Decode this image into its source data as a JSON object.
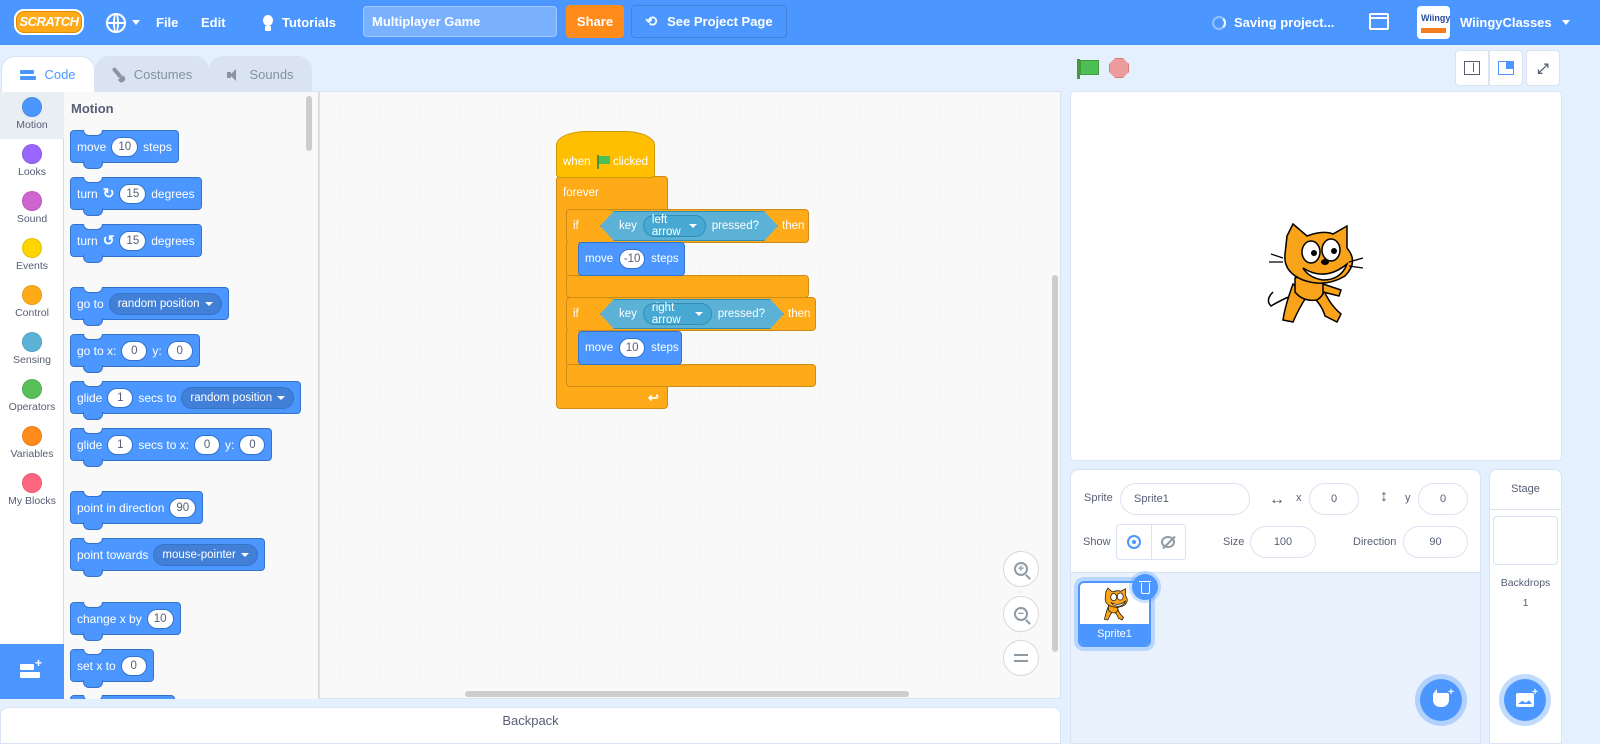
{
  "menubar": {
    "logo": "SCRATCH",
    "file": "File",
    "edit": "Edit",
    "tutorials": "Tutorials",
    "project_title": "Multiplayer Game",
    "share": "Share",
    "see_project_page": "See Project Page",
    "saving_status": "Saving project...",
    "username": "WiingyClasses",
    "avatar_text": "Wiingy"
  },
  "tabs": [
    {
      "label": "Code",
      "active": true
    },
    {
      "label": "Costumes",
      "active": false
    },
    {
      "label": "Sounds",
      "active": false
    }
  ],
  "categories": [
    {
      "label": "Motion",
      "color": "#4c97ff",
      "active": true
    },
    {
      "label": "Looks",
      "color": "#9966ff"
    },
    {
      "label": "Sound",
      "color": "#cf63cf"
    },
    {
      "label": "Events",
      "color": "#ffd500"
    },
    {
      "label": "Control",
      "color": "#ffab19"
    },
    {
      "label": "Sensing",
      "color": "#5cb1d6"
    },
    {
      "label": "Operators",
      "color": "#59c059"
    },
    {
      "label": "Variables",
      "color": "#ff8c1a"
    },
    {
      "label": "My Blocks",
      "color": "#ff6680"
    }
  ],
  "palette": {
    "title": "Motion",
    "blocks": {
      "move": {
        "a": "move",
        "v": "10",
        "b": "steps"
      },
      "turn_right": {
        "a": "turn",
        "v": "15",
        "b": "degrees"
      },
      "turn_left": {
        "a": "turn",
        "v": "15",
        "b": "degrees"
      },
      "goto": {
        "a": "go to",
        "dd": "random position"
      },
      "gotoxy": {
        "a": "go to x:",
        "x": "0",
        "b": "y:",
        "y": "0"
      },
      "glide": {
        "a": "glide",
        "v": "1",
        "b": "secs to",
        "dd": "random position"
      },
      "glidexy": {
        "a": "glide",
        "v": "1",
        "b": "secs to x:",
        "x": "0",
        "c": "y:",
        "y": "0"
      },
      "point_dir": {
        "a": "point in direction",
        "v": "90"
      },
      "point_towards": {
        "a": "point towards",
        "dd": "mouse-pointer"
      },
      "change_x": {
        "a": "change x by",
        "v": "10"
      },
      "set_x": {
        "a": "set x to",
        "v": "0"
      }
    }
  },
  "script": {
    "hat": {
      "a": "when",
      "b": "clicked"
    },
    "forever": "forever",
    "if1": {
      "if": "if",
      "key": "key",
      "dd": "left arrow",
      "pressed": "pressed?",
      "then": "then",
      "move": "move",
      "v": "-10",
      "steps": "steps"
    },
    "if2": {
      "if": "if",
      "key": "key",
      "dd": "right arrow",
      "pressed": "pressed?",
      "then": "then",
      "move": "move",
      "v": "10",
      "steps": "steps"
    },
    "loop_arrow": "↩"
  },
  "zoom": {
    "in": "+",
    "out": "−"
  },
  "sprite_info": {
    "sprite_label": "Sprite",
    "sprite_name": "Sprite1",
    "x_label": "x",
    "x": "0",
    "y_label": "y",
    "y": "0",
    "show_label": "Show",
    "size_label": "Size",
    "size": "100",
    "direction_label": "Direction",
    "direction": "90"
  },
  "sprites": [
    {
      "name": "Sprite1",
      "selected": true
    }
  ],
  "stage_selector": {
    "title": "Stage",
    "backdrops_label": "Backdrops",
    "backdrops_count": "1"
  },
  "backpack": "Backpack"
}
